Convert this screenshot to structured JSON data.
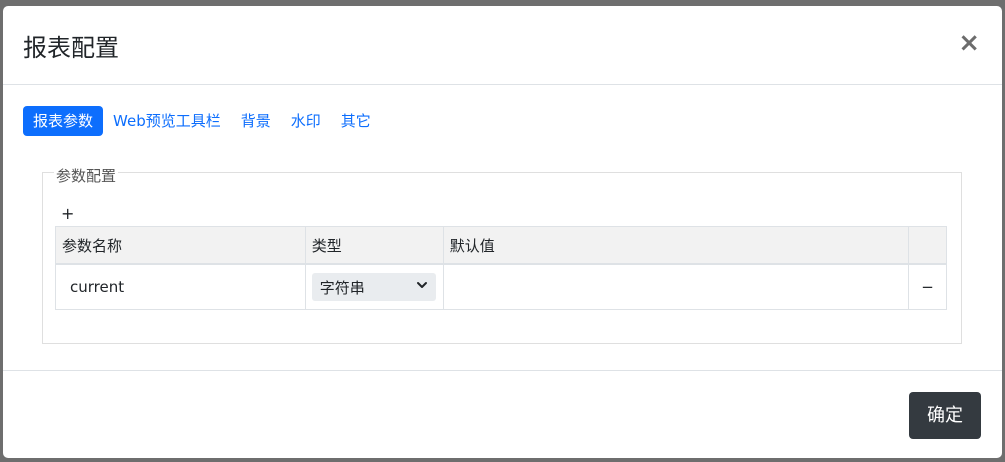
{
  "dialog": {
    "title": "报表配置",
    "close_symbol": "×",
    "tabs": [
      {
        "label": "报表参数",
        "active": true
      },
      {
        "label": "Web预览工具栏",
        "active": false
      },
      {
        "label": "背景",
        "active": false
      },
      {
        "label": "水印",
        "active": false
      },
      {
        "label": "其它",
        "active": false
      }
    ],
    "param_section": {
      "legend": "参数配置",
      "add_symbol": "+",
      "columns": [
        "参数名称",
        "类型",
        "默认值",
        ""
      ],
      "rows": [
        {
          "name": "current",
          "type": "字符串",
          "default": "",
          "remove_symbol": "−"
        }
      ]
    },
    "confirm_label": "确定"
  },
  "colors": {
    "primary": "#0d6efd",
    "dark_button": "#343a40",
    "overlay": "#6e6e6e"
  }
}
